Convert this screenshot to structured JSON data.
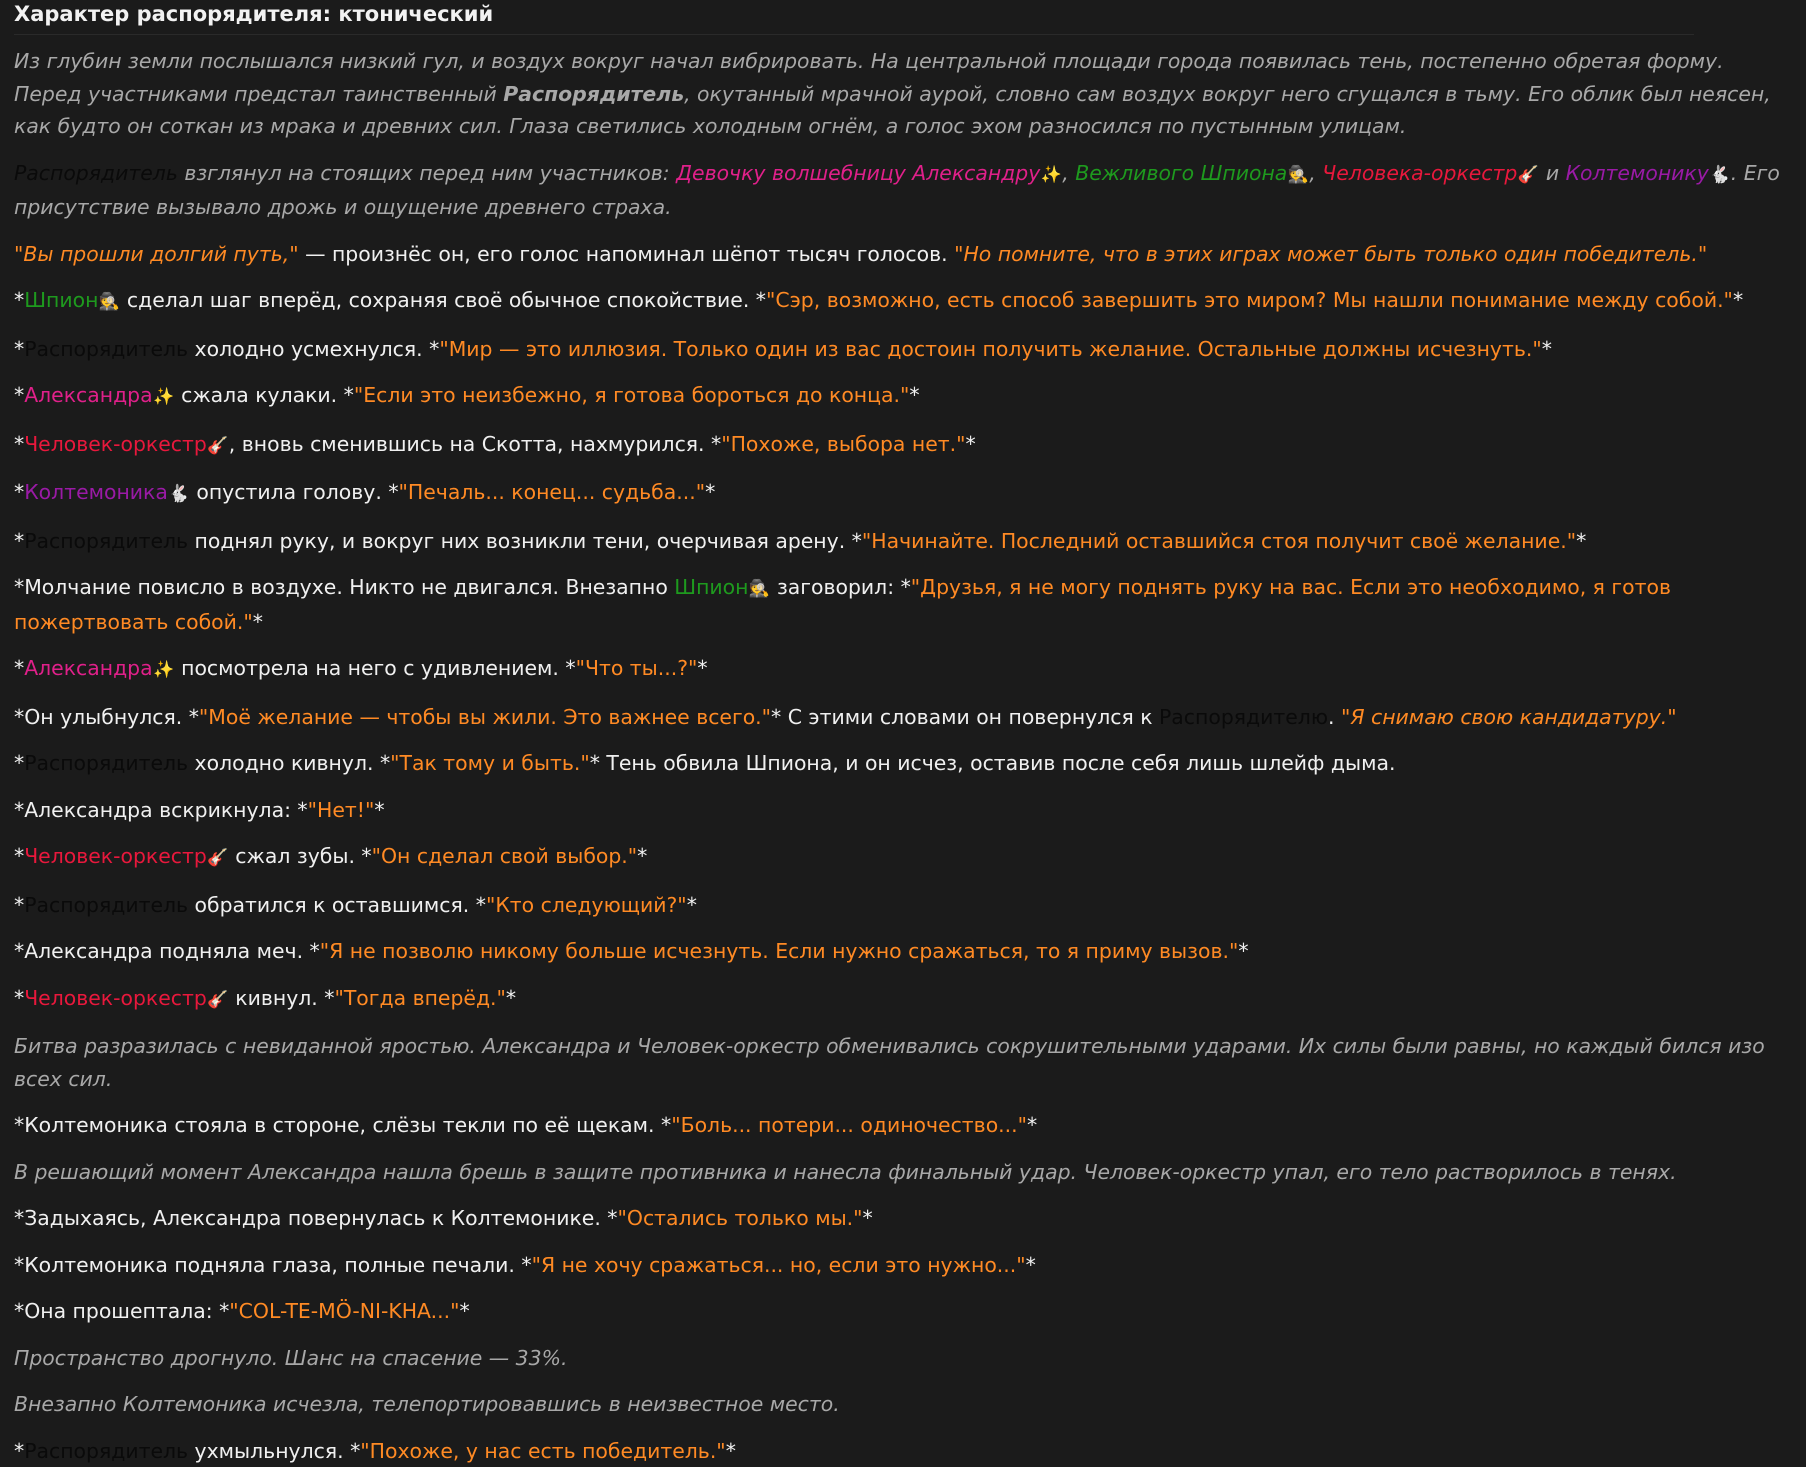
{
  "header": {
    "title": "Характер распорядителя: ктонический"
  },
  "emoji": {
    "sparkles": "✨",
    "spy": "🕵",
    "guitar": "🎸",
    "rabbit": "🐇"
  },
  "p1": {
    "a": "Из глубин земли послышался низкий гул, и воздух вокруг начал вибрировать. На центральной площади города появилась тень, постепенно обретая форму. Перед участниками предстал таинственный ",
    "b": "Распорядитель",
    "c": ", окутанный мрачной аурой, словно сам воздух вокруг него сгущался в тьму. Его облик был неясен, как будто он соткан из мрака и древних сил. Глаза светились холодным огнём, а голос эхом разносился по пустынным улицам."
  },
  "p2": {
    "disp": "Распорядитель",
    "a": " взглянул на стоящих перед ним участников: ",
    "alex": "Девочку волшебницу Александру",
    "sep1": ", ",
    "spy": "Вежливого Шпиона",
    "sep2": ", ",
    "orch": "Человека-оркестр",
    "sep3": " и ",
    "kolt": "Колтемонику",
    "b": ". Его присутствие вызывало дрожь и ощущение древнего страха."
  },
  "p3": {
    "q1": "\"Вы прошли долгий путь,\"",
    "a": " — произнёс он, его голос напоминал шёпот тысяч голосов. ",
    "q2": "\"Но помните, что в этих играх может быть только один победитель.\""
  },
  "p4": {
    "name": "Шпион",
    "a": " сделал шаг вперёд, сохраняя своё обычное спокойствие. *",
    "q": "\"Сэр, возможно, есть способ завершить это миром? Мы нашли понимание между собой.\""
  },
  "p5": {
    "name": "Распорядитель",
    "a": " холодно усмехнулся. *",
    "q": "\"Мир — это иллюзия. Только один из вас достоин получить желание. Остальные должны исчезнуть.\""
  },
  "p6": {
    "name": "Александра",
    "a": " сжала кулаки. *",
    "q": "\"Если это неизбежно, я готова бороться до конца.\""
  },
  "p7": {
    "name": "Человек-оркестр",
    "a": ", вновь сменившись на Скотта, нахмурился. *",
    "q": "\"Похоже, выбора нет.\""
  },
  "p8": {
    "name": "Колтемоника",
    "a": " опустила голову. *",
    "q": "\"Печаль... конец... судьба...\""
  },
  "p9": {
    "name": "Распорядитель",
    "a": " поднял руку, и вокруг них возникли тени, очерчивая арену. *",
    "q": "\"Начинайте. Последний оставшийся стоя получит своё желание.\""
  },
  "p10": {
    "a": "Молчание повисло в воздухе. Никто не двигался. Внезапно ",
    "name": "Шпион",
    "b": " заговорил: *",
    "q": "\"Друзья, я не могу поднять руку на вас. Если это необходимо, я готов пожертвовать собой.\""
  },
  "p11": {
    "name": "Александра",
    "a": " посмотрела на него с удивлением. *",
    "q": "\"Что ты...?\""
  },
  "p12": {
    "a": "Он улыбнулся. *",
    "q": "\"Моё желание — чтобы вы жили. Это важнее всего.\"",
    "b": "* С этими словами он повернулся к ",
    "name": "Распорядителю",
    "c": ". ",
    "q2": "\"Я снимаю свою кандидатуру.\""
  },
  "p13": {
    "name": "Распорядитель",
    "a": " холодно кивнул. *",
    "q": "\"Так тому и быть.\"",
    "b": "* Тень обвила Шпиона, и он исчез, оставив после себя лишь шлейф дыма."
  },
  "p14": {
    "a": "Александра вскрикнула: *",
    "q": "\"Нет!\""
  },
  "p15": {
    "name": "Человек-оркестр",
    "a": " сжал зубы. *",
    "q": "\"Он сделал свой выбор.\""
  },
  "p16": {
    "name": "Распорядитель",
    "a": " обратился к оставшимся. *",
    "q": "\"Кто следующий?\""
  },
  "p17": {
    "a": "Александра подняла меч. *",
    "q": "\"Я не позволю никому больше исчезнуть. Если нужно сражаться, то я приму вызов.\""
  },
  "p18": {
    "name": "Человек-оркестр",
    "a": " кивнул. *",
    "q": "\"Тогда вперёд.\""
  },
  "p19": {
    "a": "Битва разразилась с невиданной яростью. Александра и Человек-оркестр обменивались сокрушительными ударами. Их силы были равны, но каждый бился изо всех сил."
  },
  "p20": {
    "a": "Колтемоника стояла в стороне, слёзы текли по её щекам. *",
    "q": "\"Боль... потери... одиночество...\""
  },
  "p21": {
    "a": "В решающий момент Александра нашла брешь в защите противника и нанесла финальный удар. Человек-оркестр упал, его тело растворилось в тенях."
  },
  "p22": {
    "a": "Задыхаясь, Александра повернулась к Колтемонике. *",
    "q": "\"Остались только мы.\""
  },
  "p23": {
    "a": "Колтемоника подняла глаза, полные печали. *",
    "q": "\"Я не хочу сражаться... но, если это нужно...\""
  },
  "p24": {
    "a": "Она прошептала: *",
    "q": "\"COL-TE-MÖ-NI-KHA...\""
  },
  "p25": {
    "a": "Пространство дрогнуло. Шанс на спасение — 33%."
  },
  "p26": {
    "a": "Внезапно Колтемоника исчезла, телепортировавшись в неизвестное место."
  },
  "p27": {
    "name": "Распорядитель",
    "a": " ухмыльнулся. *",
    "q": "\"Похоже, у нас есть победитель.\""
  },
  "asterisk": "*"
}
